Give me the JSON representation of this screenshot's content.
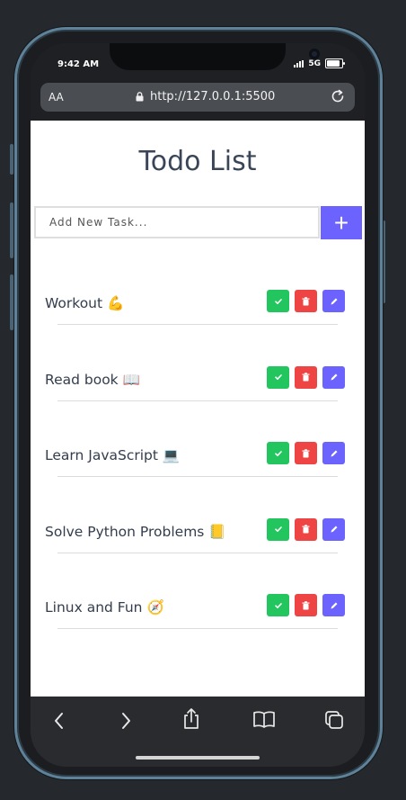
{
  "status_bar": {
    "time": "9:42 AM",
    "network": "5G"
  },
  "browser": {
    "text_size_label": "AA",
    "url": "http://127.0.0.1:5500"
  },
  "app": {
    "title": "Todo List",
    "input": {
      "placeholder": "Add New Task...",
      "value": ""
    },
    "add_button": "+",
    "tasks": [
      {
        "label": "Workout",
        "emoji": "💪"
      },
      {
        "label": "Read book",
        "emoji": "📖"
      },
      {
        "label": "Learn JavaScript",
        "emoji": "💻"
      },
      {
        "label": "Solve Python Problems",
        "emoji": "📒"
      },
      {
        "label": "Linux and Fun",
        "emoji": "🧭"
      }
    ]
  },
  "colors": {
    "accent": "#6c63ff",
    "done": "#22c55e",
    "delete": "#ef4444",
    "title": "#3a4658"
  }
}
